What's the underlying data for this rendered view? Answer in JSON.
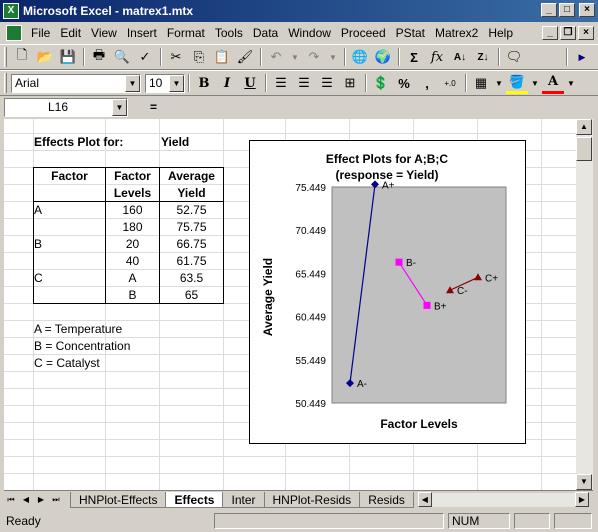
{
  "window": {
    "title": "Microsoft Excel - matrex1.mtx",
    "app_icon": "X"
  },
  "menu": [
    "File",
    "Edit",
    "View",
    "Insert",
    "Format",
    "Tools",
    "Data",
    "Window",
    "Proceed",
    "PStat",
    "Matrex2",
    "Help"
  ],
  "format_toolbar": {
    "font": "Arial",
    "size": "10",
    "bold": "B",
    "italic": "I",
    "underline": "U",
    "percent": "%",
    "comma": ","
  },
  "formula_bar": {
    "name_box": "L16",
    "equals": "=",
    "formula": ""
  },
  "sheet": {
    "header_label": "Effects Plot for:",
    "header_value": "Yield",
    "col_factor": "Factor",
    "col_levels_1": "Factor",
    "col_levels_2": "Levels",
    "col_avg_1": "Average",
    "col_avg_2": "Yield",
    "rows": [
      {
        "factor": "A",
        "level": "160",
        "avg": "52.75"
      },
      {
        "factor": "",
        "level": "180",
        "avg": "75.75"
      },
      {
        "factor": "B",
        "level": "20",
        "avg": "66.75"
      },
      {
        "factor": "",
        "level": "40",
        "avg": "61.75"
      },
      {
        "factor": "C",
        "level": "A",
        "avg": "63.5"
      },
      {
        "factor": "",
        "level": "B",
        "avg": "65"
      }
    ],
    "legend": [
      "A = Temperature",
      "B = Concentration",
      "C = Catalyst"
    ]
  },
  "chart_data": {
    "type": "line",
    "title": "Effect Plots for A;B;C",
    "subtitle": "(response = Yield)",
    "xlabel": "Factor Levels",
    "ylabel": "Average Yield",
    "ylim": [
      50.449,
      75.449
    ],
    "yticks": [
      "75.449",
      "70.449",
      "65.449",
      "60.449",
      "55.449",
      "50.449"
    ],
    "series": [
      {
        "color": "#00008b",
        "marker": "diamond",
        "points": [
          {
            "label": "A-",
            "y": 52.75
          },
          {
            "label": "A+",
            "y": 75.75
          }
        ]
      },
      {
        "color": "#ff00ff",
        "marker": "square",
        "points": [
          {
            "label": "B-",
            "y": 66.75
          },
          {
            "label": "B+",
            "y": 61.75
          }
        ]
      },
      {
        "color": "#8b0000",
        "marker": "triangle",
        "points": [
          {
            "label": "C-",
            "y": 63.5
          },
          {
            "label": "C+",
            "y": 65
          }
        ]
      }
    ]
  },
  "tabs": [
    "HNPlot-Effects",
    "Effects",
    "Inter",
    "HNPlot-Resids",
    "Resids"
  ],
  "active_tab": "Effects",
  "status": {
    "text": "Ready",
    "num": "NUM"
  }
}
